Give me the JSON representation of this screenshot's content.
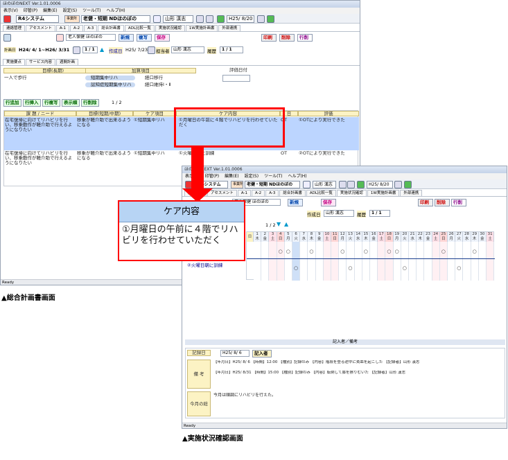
{
  "app_title": "ほのぼのNEXT Ver.1.01.0006",
  "menu": [
    "表示(V)",
    "印管(P)",
    "編集(E)",
    "設定(S)",
    "ツール(T)",
    "ヘルプ(H)"
  ],
  "menu2": [
    "表示(V)",
    "印管(P)",
    "編集(E)",
    "設定(S)",
    "ツール(T)",
    "ヘルプ(H)"
  ],
  "toolbar": {
    "system": "R4システム",
    "service_badge": "事業所",
    "office": "老健・短期 NDほのぼの",
    "user": "山形 漢志",
    "date": "H25/ 8/20"
  },
  "tabs": [
    "連絡管理",
    "アセスメント",
    "A-1",
    "A-2",
    "A-3",
    "総合計画書",
    "ADL比較一覧",
    "実施状況確認",
    "1W実施計画書",
    "外部連携"
  ],
  "tabs2": [
    "連絡管理",
    "アセスメント",
    "A-1",
    "A-2",
    "A-3",
    "総合計画書",
    "ADL比較一覧",
    "実施状況確認",
    "1W実施計画書",
    "外部連携"
  ],
  "actions": {
    "user_type": "老人保健 ほのぼの",
    "new": "新規",
    "copy": "複写",
    "save": "保存",
    "print": "印刷",
    "delete": "削除",
    "sign": "行削"
  },
  "plan": {
    "label": "計画日",
    "period": "H24/ 4/ 1~H26/ 3/31",
    "page": "1 / 1",
    "created_label": "作成日",
    "created": "H25/ 7/23",
    "staff_label": "担当者",
    "staff": "山形 漢志",
    "history_label": "履歴",
    "history": "1 / 1"
  },
  "subtabs": [
    "実施要点",
    "サービス内容",
    "週間計画"
  ],
  "goal": {
    "header": "目標(長期)",
    "value": "一人で歩行",
    "add_header": "加算項目",
    "options": [
      "短期集中リハ",
      "認知症短期集中リハ"
    ],
    "checks": [
      "経口移行",
      "経口維持Ⅰ・Ⅱ"
    ],
    "eval_header": "評価日付"
  },
  "row_buttons": [
    "行追加",
    "行挿入",
    "行複写",
    "表示順",
    "行削除"
  ],
  "pager": "1 / 2",
  "columns": [
    "課 題 / ニード",
    "目標(短期/中期)",
    "ケア項目",
    "ケア内容",
    "日",
    "評価"
  ],
  "rows": [
    {
      "need": "在宅復帰に向けてリハビリを行い、移乗動作が軽介助で行えるようになりたい",
      "goal": "移乗が軽介助で出来るようになる",
      "item": "①短期集中リハ",
      "content": "①月曜日の午前に４階でリハビリを行わせていただく",
      "day": "OT",
      "eval": "①OTにより実行できた"
    },
    {
      "need": "在宅復帰に向けてリハビリを行い、移乗動作が軽介助で行えるようになりたい",
      "goal": "移乗が軽介助で出来るようになる",
      "item": "①短期集中リハ",
      "content": "①火曜日朝に訓練",
      "day": "OT",
      "eval": "②OTにより実行できた"
    }
  ],
  "popup": {
    "header": "ケア内容",
    "text": "①月曜日の午前に４階でリハビリを行わせていただく"
  },
  "grid": {
    "day_label": "日",
    "days": [
      "1",
      "2",
      "3",
      "4",
      "5",
      "6",
      "7",
      "8",
      "9",
      "10",
      "11",
      "12",
      "13",
      "14",
      "15",
      "16",
      "17",
      "18",
      "19",
      "20",
      "21",
      "22",
      "23",
      "24",
      "25",
      "26",
      "27",
      "28",
      "29",
      "30",
      "31"
    ],
    "weekdays": [
      "木",
      "金",
      "土",
      "日",
      "月",
      "火",
      "水",
      "木",
      "金",
      "土",
      "日",
      "月",
      "火",
      "水",
      "木",
      "金",
      "土",
      "日",
      "月",
      "火",
      "水",
      "木",
      "金",
      "土",
      "日",
      "月",
      "火",
      "水",
      "木",
      "金",
      "土"
    ],
    "rows": [
      {
        "label": "",
        "marks": [
          "4",
          "5",
          "8",
          "12",
          "15",
          "18",
          "19",
          "25",
          "29"
        ]
      },
      {
        "label": "②火曜日朝に訓練",
        "marks": [
          "6",
          "13",
          "20",
          "27"
        ]
      }
    ],
    "row1_extra": "火",
    "row2_extra": [
      "8",
      "12"
    ]
  },
  "record": {
    "section_label": "記入者／備考",
    "date_label": "記録日",
    "date": "H25/ 8/ 6",
    "writer_label": "記入者",
    "note_label": "備 考",
    "notes": [
      "【年月日】H25/ 8/ 6 【時間】12:00 【種別】記録のみ 【内容】階段を登る途中に貧血を起こした 【記録者】山形 漢志",
      "【年月日】H25/ 8/31 【時間】15:00 【種別】記録のみ 【内容】転倒して膝を擦りむいた 【記録者】山形 漢志"
    ],
    "monthly_label": "今月の総括",
    "monthly": "今月は順調にリハビリを行えた。"
  },
  "status": "Ready",
  "captions": {
    "left": "▲総合計画書画面",
    "right": "▲実施状況確認画面"
  },
  "colors": {
    "accent": "#ff0000",
    "header": "#fcf3c4",
    "selection": "#bcd5ff",
    "popup_header": "#b7d4f4"
  }
}
